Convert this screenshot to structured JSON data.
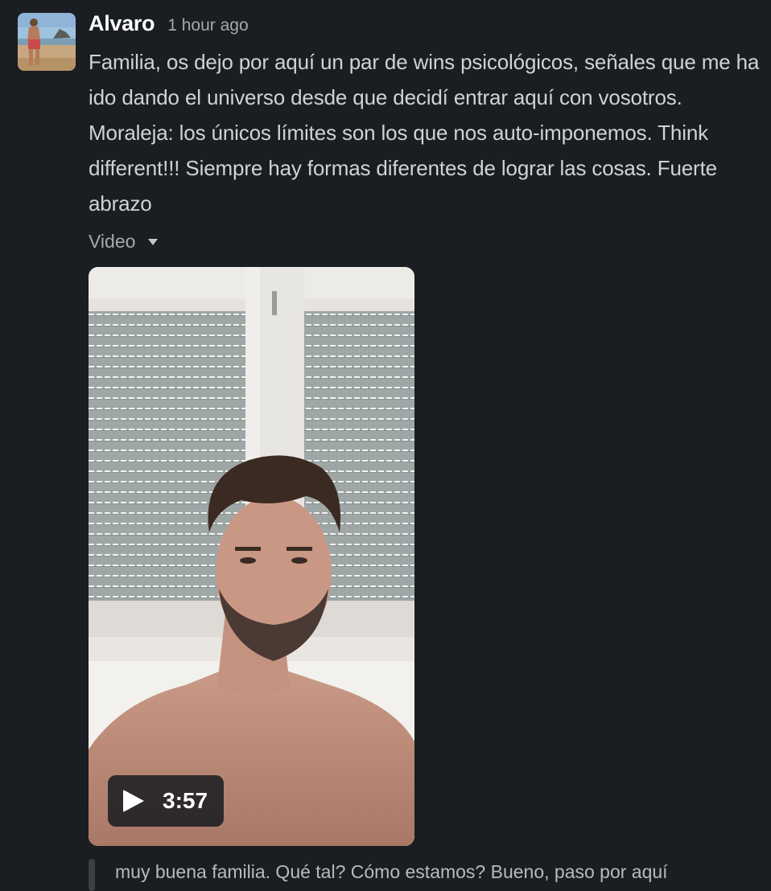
{
  "message": {
    "author": "Alvaro",
    "timestamp": "1 hour ago",
    "text": "Familia, os dejo por aquí un par de wins psicológicos, señales que me ha ido dando el universo desde que decidí entrar aquí con vosotros. Moraleja: los únicos límites son los que nos auto-imponemos. Think different!!! Siempre hay formas diferentes de lograr las cosas. Fuerte abrazo",
    "attachment_label": "Video",
    "attachment_icon": "caret-down-icon",
    "video": {
      "duration": "3:57",
      "play_icon": "play-icon"
    }
  },
  "reply_preview": {
    "text": "muy buena familia. Qué tal? Cómo estamos? Bueno, paso por aquí"
  },
  "colors": {
    "background": "#1a1d21",
    "author": "#ffffff",
    "body_text": "#d1d2d3",
    "muted_text": "#a7a8aa"
  }
}
